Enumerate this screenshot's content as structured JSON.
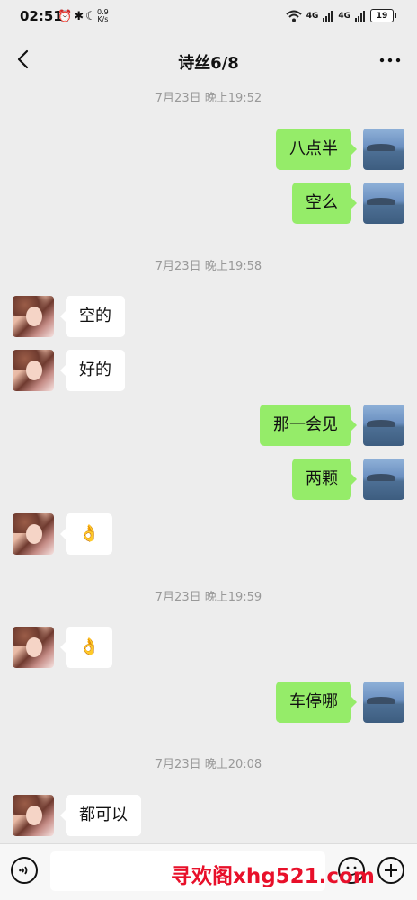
{
  "status_bar": {
    "time": "02:51",
    "speed_value": "0.9",
    "speed_unit": "K/s",
    "network_1": "4G",
    "network_2": "4G",
    "battery": "19"
  },
  "header": {
    "title": "诗丝6/8"
  },
  "messages": [
    {
      "type": "time",
      "text": "7月23日 晚上19:52"
    },
    {
      "type": "mine",
      "text": "八点半"
    },
    {
      "type": "mine",
      "text": "空么"
    },
    {
      "type": "time",
      "text": "7月23日 晚上19:58"
    },
    {
      "type": "other",
      "text": "空的"
    },
    {
      "type": "other",
      "text": "好的"
    },
    {
      "type": "mine",
      "text": "那一会见"
    },
    {
      "type": "mine",
      "text": "两颗"
    },
    {
      "type": "other",
      "text": "👌"
    },
    {
      "type": "time",
      "text": "7月23日 晚上19:59"
    },
    {
      "type": "other",
      "text": "👌"
    },
    {
      "type": "mine",
      "text": "车停哪"
    },
    {
      "type": "time",
      "text": "7月23日 晚上20:08"
    },
    {
      "type": "other",
      "text": "都可以"
    }
  ],
  "input": {
    "value": "",
    "placeholder": ""
  },
  "watermark": "寻欢阁xhg521.com",
  "colors": {
    "background": "#ededed",
    "my_bubble": "#95ec69",
    "other_bubble": "#ffffff",
    "timestamp": "#999999",
    "watermark": "#e8102a"
  }
}
